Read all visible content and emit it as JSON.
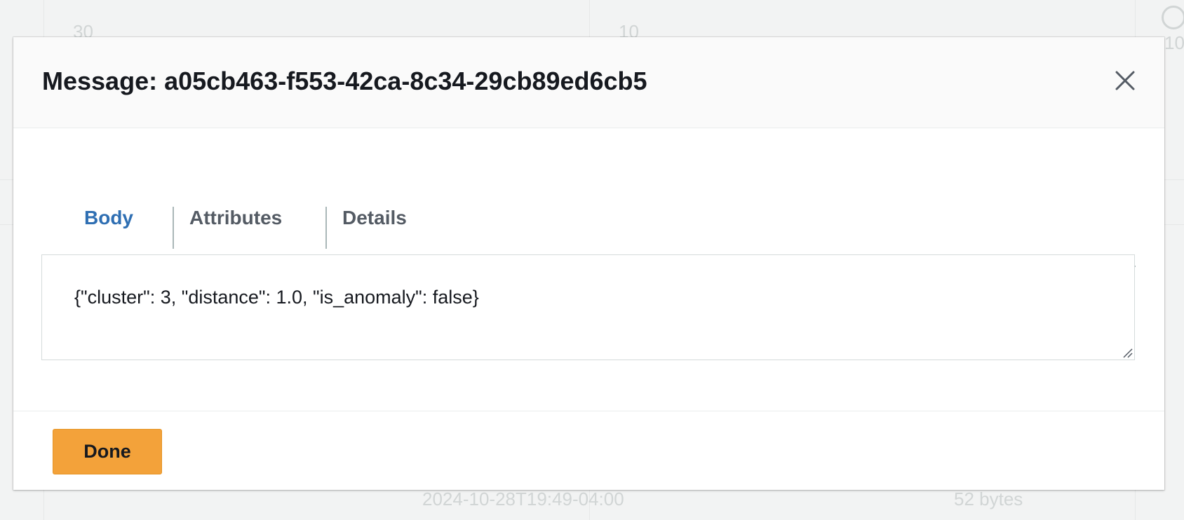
{
  "background": {
    "row_top_left_value": "30",
    "row_top_mid_value": "10",
    "row_top_right_value": "10",
    "bottom_timestamp": "2024-10-28T19:49-04:00",
    "bottom_size": "52 bytes"
  },
  "modal": {
    "title": "Message: a05cb463-f553-42ca-8c34-29cb89ed6cb5",
    "close_icon": "close-icon",
    "tabs": [
      {
        "label": "Body",
        "active": true
      },
      {
        "label": "Attributes",
        "active": false
      },
      {
        "label": "Details",
        "active": false
      }
    ],
    "body_text": "{\"cluster\": 3, \"distance\": 1.0, \"is_anomaly\": false}",
    "done_label": "Done"
  },
  "colors": {
    "active_tab": "#2f6fb3",
    "primary_button": "#f3a23a"
  }
}
